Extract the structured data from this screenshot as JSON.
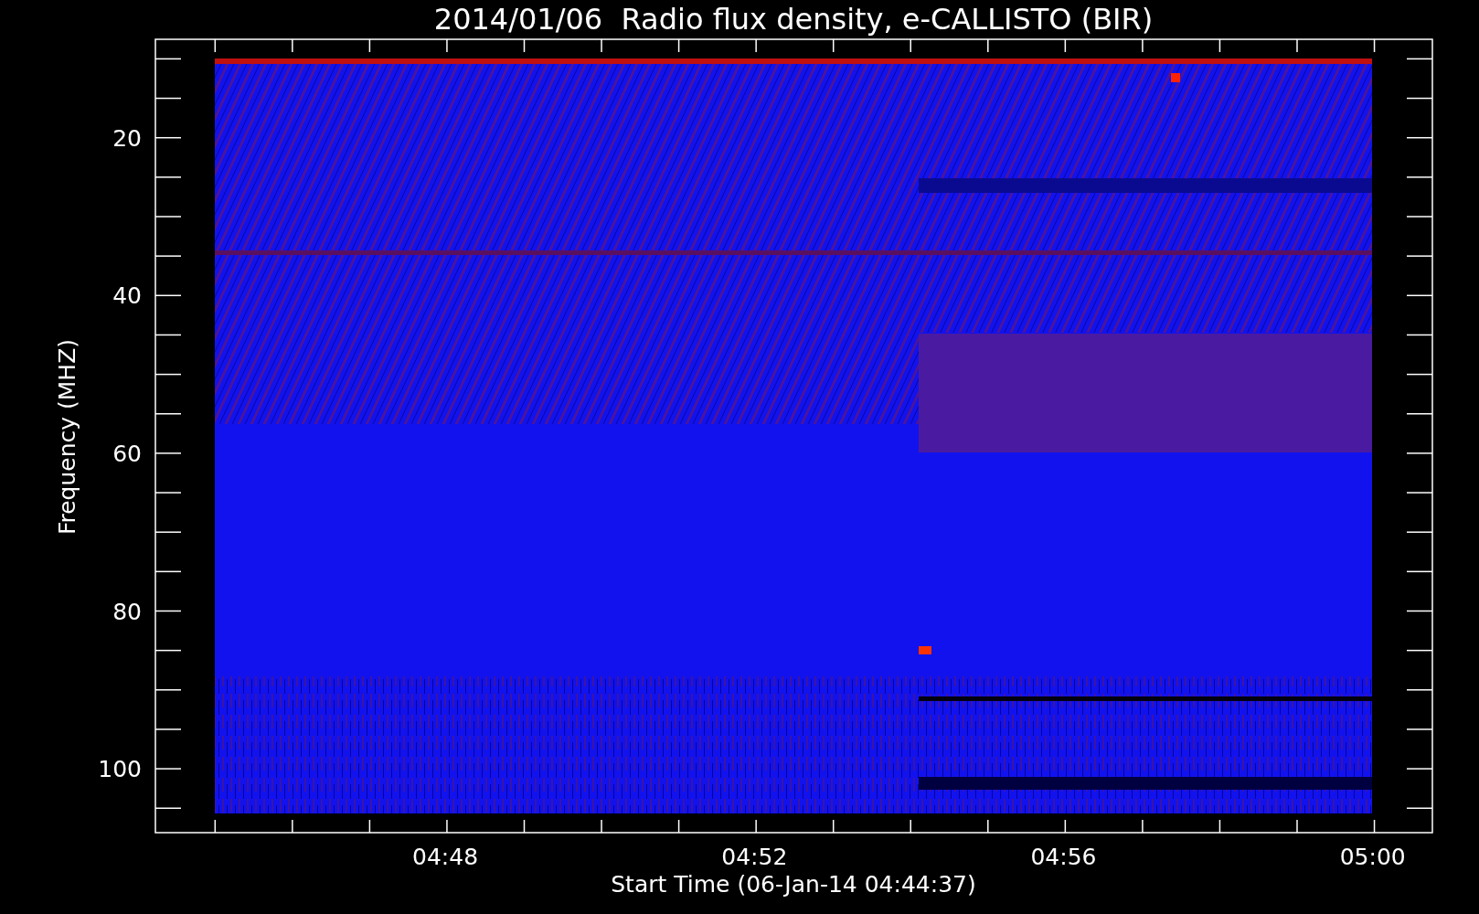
{
  "title": "2014/01/06  Radio flux density, e-CALLISTO (BIR)",
  "y_axis": {
    "label": "Frequency (MHZ)",
    "ticks": [
      "20",
      "40",
      "60",
      "80",
      "100"
    ]
  },
  "x_axis": {
    "label": "Start Time (06-Jan-14 04:44:37)",
    "ticks": [
      "04:48",
      "04:52",
      "04:56",
      "05:00"
    ]
  }
}
